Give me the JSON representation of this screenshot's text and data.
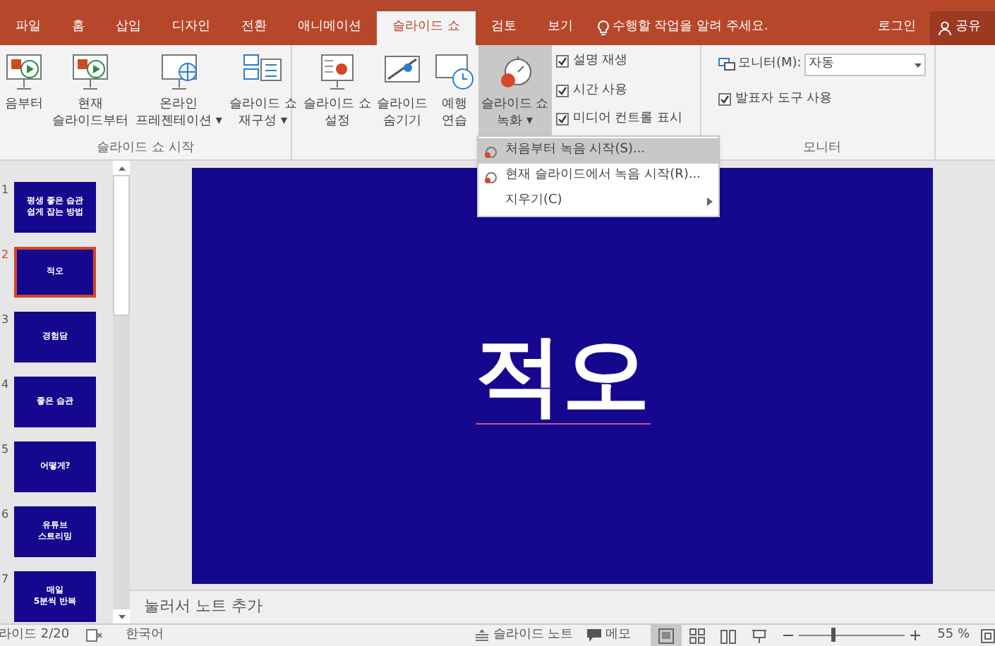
{
  "tabs": [
    {
      "label": "파일",
      "selected": false
    },
    {
      "label": "홈",
      "selected": false
    },
    {
      "label": "삽입",
      "selected": false
    },
    {
      "label": "디자인",
      "selected": false
    },
    {
      "label": "전환",
      "selected": false
    },
    {
      "label": "애니메이션",
      "selected": false
    },
    {
      "label": "슬라이드 쇼",
      "selected": true
    },
    {
      "label": "검토",
      "selected": false
    },
    {
      "label": "보기",
      "selected": false
    }
  ],
  "tell_me": "수행할 작업을 알려 주세요.",
  "sign_in": "로그인",
  "share": "공유",
  "ribbon": {
    "start_group": {
      "label": "슬라이드 쇼 시작",
      "buttons": [
        {
          "label": "음부터",
          "kind": "play",
          "pressed": false
        },
        {
          "label": "현재\n슬라이드부터",
          "kind": "play",
          "pressed": false
        },
        {
          "label": "온라인\n프레젠테이션 ▾",
          "kind": "globe",
          "pressed": false
        },
        {
          "label": "슬라이드 쇼\n재구성 ▾",
          "kind": "list",
          "pressed": false
        }
      ]
    },
    "setup_group": {
      "buttons": [
        {
          "label": "슬라이드 쇼\n설정",
          "kind": "setup",
          "pressed": false
        },
        {
          "label": "슬라이드\n숨기기",
          "kind": "hide",
          "pressed": false
        },
        {
          "label": "예행\n연습",
          "kind": "timer",
          "pressed": false
        },
        {
          "label": "슬라이드 쇼\n녹화 ▾",
          "kind": "record",
          "pressed": true
        }
      ],
      "options": [
        {
          "label": "설명 재생",
          "checked": true
        },
        {
          "label": "시간 사용",
          "checked": true
        },
        {
          "label": "미디어 컨트롤 표시",
          "checked": true
        }
      ]
    },
    "monitor_group": {
      "label": "모니터",
      "monitor_label": "모니터(M):",
      "monitor_value": "자동",
      "presenter_view": {
        "label": "발표자 도구 사용",
        "checked": true
      }
    }
  },
  "record_menu": [
    {
      "label": "처음부터 녹음 시작(S)...",
      "selected": true,
      "submenu": false
    },
    {
      "label": "현재 슬라이드에서 녹음 시작(R)...",
      "selected": false,
      "submenu": false
    },
    {
      "label": "지우기(C)",
      "selected": false,
      "submenu": true
    }
  ],
  "slides": [
    {
      "number": "1",
      "title": "평생 좋은 습관\n쉽게 잡는 방법",
      "selected": false
    },
    {
      "number": "2",
      "title": "적오",
      "selected": true
    },
    {
      "number": "3",
      "title": "경험담",
      "selected": false
    },
    {
      "number": "4",
      "title": "좋은 습관",
      "selected": false
    },
    {
      "number": "5",
      "title": "어떻게?",
      "selected": false
    },
    {
      "number": "6",
      "title": "유튜브\n스트리밍",
      "selected": false
    },
    {
      "number": "7",
      "title": "매일\n5분씩 반복",
      "selected": false
    }
  ],
  "current_slide": {
    "title": "적오"
  },
  "notes_placeholder": "눌러서 노트 추가",
  "status_bar": {
    "slide_position": "라이드 2/20",
    "language": "한국어",
    "notes_button": "슬라이드 노트",
    "comments_button": "메모",
    "views": [
      {
        "kind": "normal",
        "selected": true
      },
      {
        "kind": "sorter",
        "selected": false
      },
      {
        "kind": "reading",
        "selected": false
      },
      {
        "kind": "show",
        "selected": false
      }
    ],
    "zoom": {
      "level": 0.3,
      "reading": "55 %"
    }
  }
}
